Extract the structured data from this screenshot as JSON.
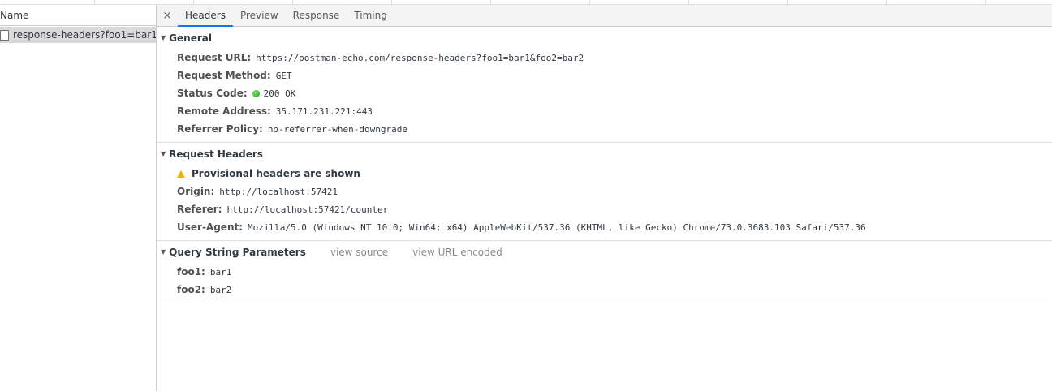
{
  "left_panel": {
    "header": "Name",
    "rows": [
      {
        "label": "response-headers?foo1=bar1..."
      }
    ]
  },
  "tabs": {
    "close_glyph": "×",
    "items": [
      {
        "label": "Headers",
        "active": true
      },
      {
        "label": "Preview",
        "active": false
      },
      {
        "label": "Response",
        "active": false
      },
      {
        "label": "Timing",
        "active": false
      }
    ]
  },
  "general": {
    "title": "General",
    "request_url_label": "Request URL:",
    "request_url": "https://postman-echo.com/response-headers?foo1=bar1&foo2=bar2",
    "request_method_label": "Request Method:",
    "request_method": "GET",
    "status_code_label": "Status Code:",
    "status_code": "200 OK",
    "remote_address_label": "Remote Address:",
    "remote_address": "35.171.231.221:443",
    "referrer_policy_label": "Referrer Policy:",
    "referrer_policy": "no-referrer-when-downgrade"
  },
  "request_headers": {
    "title": "Request Headers",
    "warning": "Provisional headers are shown",
    "origin_label": "Origin:",
    "origin": "http://localhost:57421",
    "referer_label": "Referer:",
    "referer": "http://localhost:57421/counter",
    "user_agent_label": "User-Agent:",
    "user_agent": "Mozilla/5.0 (Windows NT 10.0; Win64; x64) AppleWebKit/537.36 (KHTML, like Gecko) Chrome/73.0.3683.103 Safari/537.36"
  },
  "query_params": {
    "title": "Query String Parameters",
    "view_source": "view source",
    "view_url_encoded": "view URL encoded",
    "params": [
      {
        "key": "foo1:",
        "value": "bar1"
      },
      {
        "key": "foo2:",
        "value": "bar2"
      }
    ]
  },
  "colors": {
    "active_tab_underline": "#1a73e8",
    "status_ok": "#1aa51a",
    "warning": "#f0b400"
  }
}
